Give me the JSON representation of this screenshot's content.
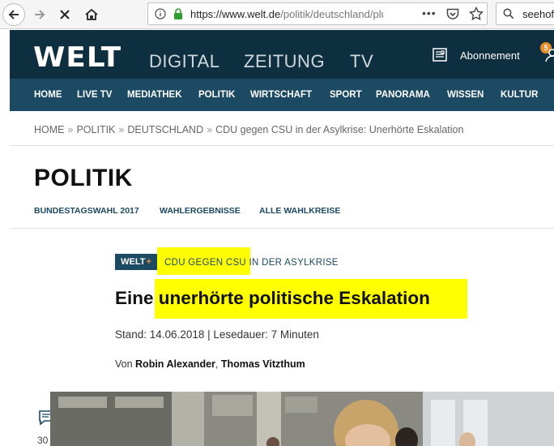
{
  "browser": {
    "url_host": "https://www.welt.de",
    "url_path": "/politik/deutschland/plu",
    "more_label": "•••",
    "search_text": "seehof"
  },
  "header": {
    "logo": "WELT",
    "links": [
      "DIGITAL",
      "ZEITUNG",
      "TV"
    ],
    "abo_label": "Abonnement",
    "notification_count": "5"
  },
  "nav": {
    "items": [
      "HOME",
      "LIVE TV",
      "MEDIATHEK",
      "POLITIK",
      "WIRTSCHAFT",
      "SPORT",
      "PANORAMA",
      "WISSEN",
      "KULTUR"
    ]
  },
  "breadcrumb": {
    "items": [
      "HOME",
      "POLITIK",
      "DEUTSCHLAND",
      "CDU gegen CSU in der Asylkrise: Unerhörte Eskalation"
    ],
    "separator": "»"
  },
  "section": {
    "title": "POLITIK",
    "sub_links": [
      "BUNDESTAGSWAHL 2017",
      "WAHLERGEBNISSE",
      "ALLE WAHLKREISE"
    ]
  },
  "article": {
    "badge_main": "WELT",
    "badge_plus": "+",
    "kicker": "CDU GEGEN CSU IN DER ASYLKRISE",
    "headline": "Eine unerhörte politische Eskalation",
    "stand": "Stand: 14.06.2018 | Lesedauer: 7 Minuten",
    "byline_prefix": "Von ",
    "author1": "Robin Alexander",
    "byline_sep": ", ",
    "author2": "Thomas Vitzthum",
    "comment_count": "30"
  },
  "colors": {
    "header_bg": "#0e2f3f",
    "nav_bg": "#1c4a63",
    "highlight": "#ffff00",
    "accent": "#e98e2b"
  }
}
